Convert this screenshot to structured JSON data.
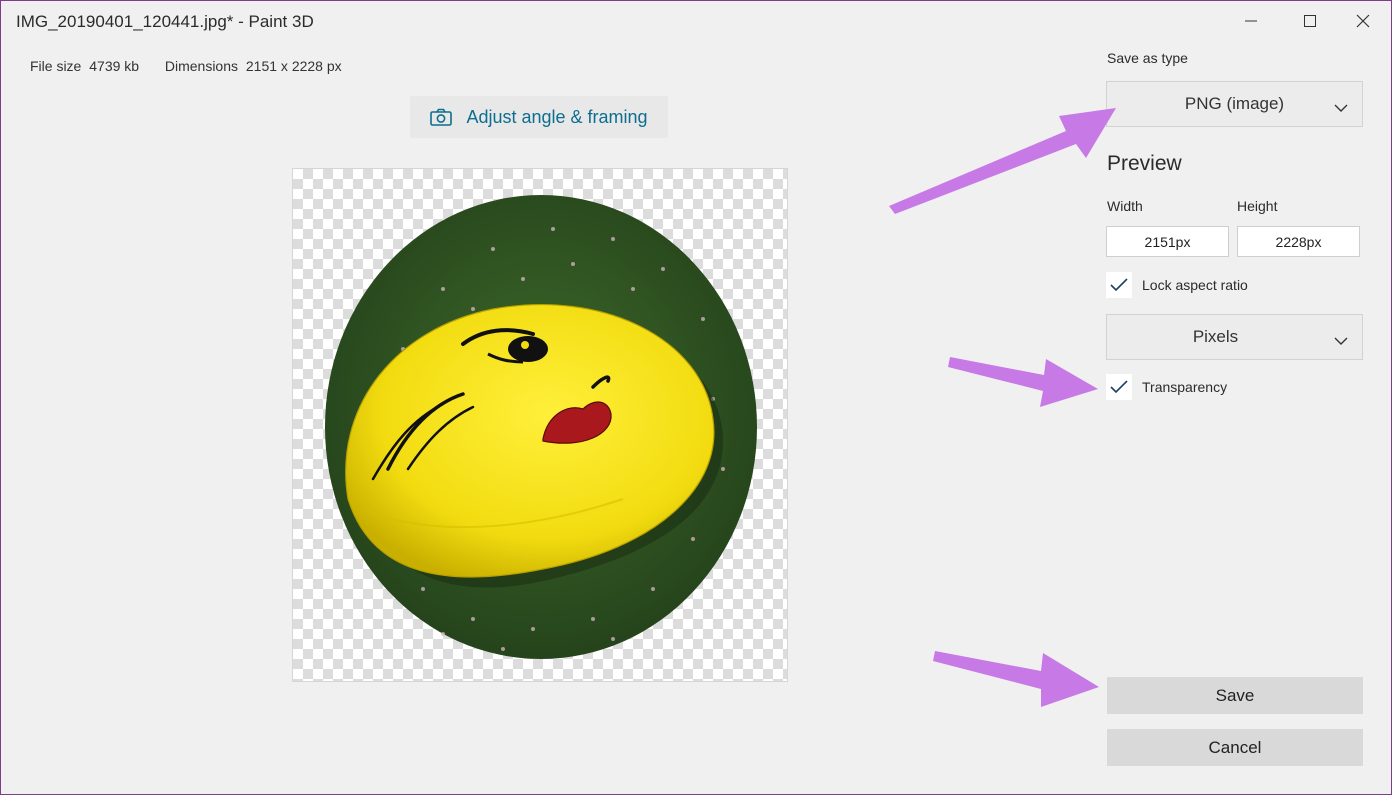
{
  "window": {
    "title": "IMG_20190401_120441.jpg* - Paint 3D",
    "minimize_icon": "minimize-icon",
    "maximize_icon": "maximize-icon",
    "close_icon": "close-icon"
  },
  "file_info": {
    "file_size_label": "File size",
    "file_size_value": "4739 kb",
    "dimensions_label": "Dimensions",
    "dimensions_value": "2151 x 2228 px"
  },
  "canvas": {
    "adjust_button": {
      "icon": "camera-icon",
      "label": "Adjust angle & framing"
    },
    "image_subject": "yellow pillow with face on green carpet, cropped to ellipse with transparent background"
  },
  "panel": {
    "save_as_type_label": "Save as type",
    "save_as_type_value": "PNG (image)",
    "preview_heading": "Preview",
    "width_label": "Width",
    "height_label": "Height",
    "width_value": "2151px",
    "height_value": "2228px",
    "lock_aspect_label": "Lock aspect ratio",
    "lock_aspect_checked": true,
    "units_value": "Pixels",
    "transparency_label": "Transparency",
    "transparency_checked": true,
    "save_label": "Save",
    "cancel_label": "Cancel"
  },
  "annotations": {
    "arrow_color": "#c77ae6"
  },
  "colors": {
    "accent": "#0e6e8f",
    "frame_border": "#7a3f86"
  }
}
